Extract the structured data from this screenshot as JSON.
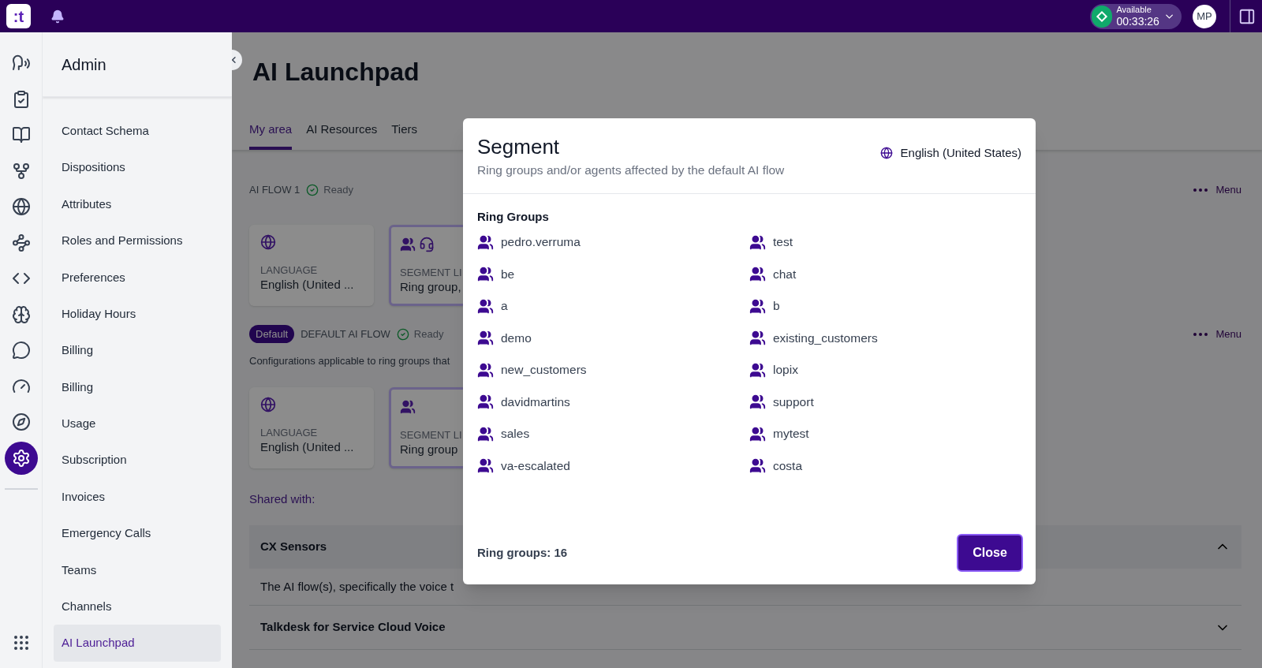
{
  "topbar": {
    "logo": ":t",
    "status": {
      "label": "Available",
      "timer": "00:33:26"
    },
    "avatar": "MP"
  },
  "rail": [
    {
      "kind": "speech",
      "selected": false
    },
    {
      "kind": "clipboard",
      "selected": false
    },
    {
      "kind": "book",
      "selected": false
    },
    {
      "kind": "fork",
      "selected": false
    },
    {
      "kind": "globe",
      "selected": false
    },
    {
      "kind": "waypoints",
      "selected": false
    },
    {
      "kind": "code",
      "selected": false
    },
    {
      "kind": "brain",
      "selected": false
    },
    {
      "kind": "chat",
      "selected": false
    },
    {
      "kind": "gauge",
      "selected": false
    },
    {
      "kind": "compass",
      "selected": false
    },
    {
      "kind": "settings",
      "selected": true
    }
  ],
  "sidebar": {
    "title": "Admin",
    "items": [
      {
        "label": "Contact Schema",
        "selected": false
      },
      {
        "label": "Dispositions",
        "selected": false
      },
      {
        "label": "Attributes",
        "selected": false
      },
      {
        "label": "Roles and Permissions",
        "selected": false
      },
      {
        "label": "Preferences",
        "selected": false
      },
      {
        "label": "Holiday Hours",
        "selected": false
      },
      {
        "label": "Billing",
        "selected": false
      },
      {
        "label": "Billing",
        "selected": false
      },
      {
        "label": "Usage",
        "selected": false
      },
      {
        "label": "Subscription",
        "selected": false
      },
      {
        "label": "Invoices",
        "selected": false
      },
      {
        "label": "Emergency Calls",
        "selected": false
      },
      {
        "label": "Teams",
        "selected": false
      },
      {
        "label": "Channels",
        "selected": false
      },
      {
        "label": "AI Launchpad",
        "selected": true
      }
    ]
  },
  "page": {
    "title": "AI Launchpad",
    "tabs": [
      {
        "label": "My area",
        "selected": true
      },
      {
        "label": "AI Resources",
        "selected": false
      },
      {
        "label": "Tiers",
        "selected": false
      }
    ],
    "flows": [
      {
        "label": "AI FLOW 1",
        "status": "Ready",
        "menu": "Menu",
        "cards": [
          {
            "kind": "language",
            "label": "LANGUAGE",
            "value": "English (United ..."
          },
          {
            "kind": "segment",
            "label": "SEGMENT LI",
            "value": "Ring group,",
            "agents": true
          }
        ]
      },
      {
        "badge": "Default",
        "label": "DEFAULT AI FLOW",
        "status": "Ready",
        "menu": "Menu",
        "description": "Configurations applicable to ring groups that",
        "cards": [
          {
            "kind": "language",
            "label": "LANGUAGE",
            "value": "English (United ..."
          },
          {
            "kind": "segment",
            "label": "SEGMENT LI",
            "value": "Ring group",
            "agents": false
          }
        ]
      }
    ],
    "shared_with": "Shared with:",
    "accordions": [
      {
        "title": "CX Sensors",
        "expanded": true,
        "body": "The AI flow(s), specifically the voice t"
      },
      {
        "title": "Talkdesk for Service Cloud Voice",
        "expanded": false
      }
    ]
  },
  "modal": {
    "title": "Segment",
    "subtitle": "Ring groups and/or agents affected by the default AI flow",
    "language": "English (United States)",
    "section": "Ring Groups",
    "groups": [
      "pedro.verruma",
      "test",
      "be",
      "chat",
      "a",
      "b",
      "demo",
      "existing_customers",
      "new_customers",
      "lopix",
      "davidmartins",
      "support",
      "sales",
      "mytest",
      "va-escalated",
      "costa"
    ],
    "count": "Ring groups: 16",
    "close": "Close"
  }
}
